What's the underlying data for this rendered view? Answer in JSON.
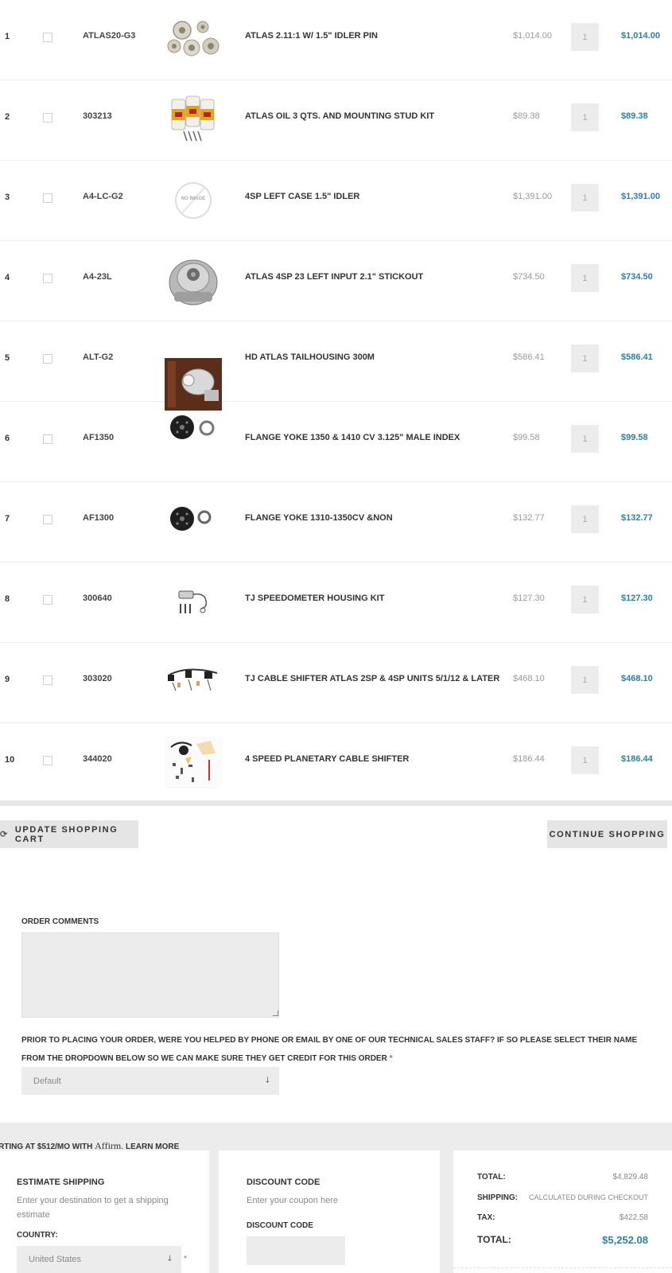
{
  "cart": {
    "items": [
      {
        "index": "1",
        "sku": "ATLAS20-G3",
        "name": "ATLAS 2.11:1 W/ 1.5\" IDLER PIN",
        "price": "$1,014.00",
        "qty": "1",
        "subtotal": "$1,014.00",
        "image_icon": "gear-set-icon"
      },
      {
        "index": "2",
        "sku": "303213",
        "name": "ATLAS OIL 3 QTS. AND MOUNTING STUD KIT",
        "price": "$89.38",
        "qty": "1",
        "subtotal": "$89.38",
        "image_icon": "oil-bottles-icon"
      },
      {
        "index": "3",
        "sku": "A4-LC-G2",
        "name": "4SP LEFT CASE 1.5\" IDLER",
        "price": "$1,391.00",
        "qty": "1",
        "subtotal": "$1,391.00",
        "image_icon": "no-image-icon",
        "image_text": "NO IMAGE"
      },
      {
        "index": "4",
        "sku": "A4-23L",
        "name": "ATLAS 4SP 23 LEFT INPUT 2.1\" STICKOUT",
        "price": "$734.50",
        "qty": "1",
        "subtotal": "$734.50",
        "image_icon": "transfer-case-icon"
      },
      {
        "index": "5",
        "sku": "ALT-G2",
        "name": "HD ATLAS TAILHOUSING 300M",
        "price": "$586.41",
        "qty": "1",
        "subtotal": "$586.41",
        "image_icon": "tailhousing-photo-icon"
      },
      {
        "index": "6",
        "sku": "AF1350",
        "name": "FLANGE YOKE 1350 & 1410 CV 3.125\" MALE INDEX",
        "price": "$99.58",
        "qty": "1",
        "subtotal": "$99.58",
        "image_icon": "flange-yoke-icon"
      },
      {
        "index": "7",
        "sku": "AF1300",
        "name": "FLANGE YOKE 1310-1350CV &NON",
        "price": "$132.77",
        "qty": "1",
        "subtotal": "$132.77",
        "image_icon": "flange-yoke-icon"
      },
      {
        "index": "8",
        "sku": "300640",
        "name": "TJ SPEEDOMETER HOUSING KIT",
        "price": "$127.30",
        "qty": "1",
        "subtotal": "$127.30",
        "image_icon": "speedometer-kit-icon"
      },
      {
        "index": "9",
        "sku": "303020",
        "name": "TJ CABLE SHIFTER ATLAS 2SP & 4SP UNITS 5/1/12 & LATER",
        "price": "$468.10",
        "qty": "1",
        "subtotal": "$468.10",
        "image_icon": "cable-shifter-icon"
      },
      {
        "index": "10",
        "sku": "344020",
        "name": "4 SPEED PLANETARY CABLE SHIFTER",
        "price": "$186.44",
        "qty": "1",
        "subtotal": "$186.44",
        "image_icon": "planetary-shifter-icon"
      }
    ],
    "update_label": "UPDATE SHOPPING CART",
    "continue_label": "CONTINUE SHOPPING"
  },
  "order_comments": {
    "label": "ORDER COMMENTS",
    "value": ""
  },
  "sales_staff": {
    "question": "PRIOR TO PLACING YOUR ORDER, WERE YOU HELPED BY PHONE OR EMAIL BY ONE OF OUR TECHNICAL SALES STAFF? IF SO PLEASE SELECT THEIR NAME FROM THE DROPDOWN BELOW SO WE CAN MAKE SURE THEY GET CREDIT FOR THIS ORDER",
    "required_mark": "*",
    "selected": "Default"
  },
  "affirm": {
    "prefix": "RTING AT $512/MO WITH",
    "logo": "Affirm.",
    "learn_more": "LEARN MORE"
  },
  "estimate_shipping": {
    "title": "ESTIMATE SHIPPING",
    "description": "Enter your destination to get a shipping estimate",
    "country_label": "COUNTRY:",
    "country_value": "United States",
    "required_mark": "*"
  },
  "discount": {
    "title": "DISCOUNT CODE",
    "description": "Enter your coupon here",
    "field_label": "DISCOUNT CODE",
    "value": ""
  },
  "totals": {
    "subtotal_label": "TOTAL:",
    "subtotal_value": "$4,829.48",
    "shipping_label": "SHIPPING:",
    "shipping_value": "CALCULATED DURING CHECKOUT",
    "tax_label": "TAX:",
    "tax_value": "$422.58",
    "grand_label": "TOTAL:",
    "grand_value": "$5,252.08"
  },
  "colors": {
    "accent": "#2f7fa0",
    "muted": "#999999",
    "panel_bg": "#ececec"
  }
}
